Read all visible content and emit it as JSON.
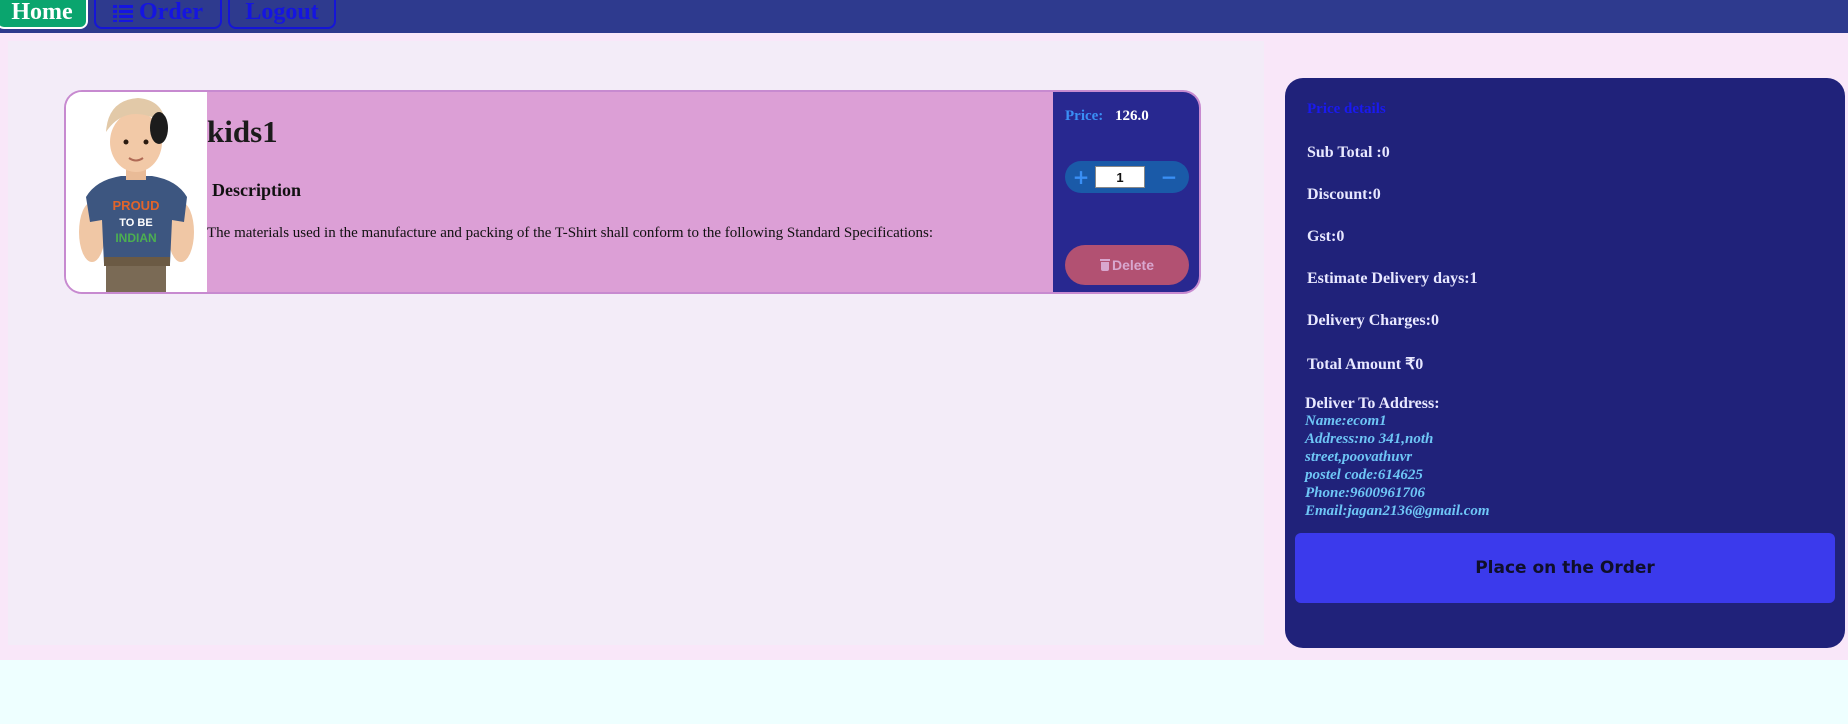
{
  "nav": {
    "home_label": "Home",
    "order_label": "Order",
    "logout_label": "Logout"
  },
  "product": {
    "name": "kids1",
    "description_heading": "Description",
    "description": "The materials used in the manufacture and packing of the T-Shirt shall conform to the following Standard Specifications:",
    "price_label": "Price:",
    "price_value": "126.0",
    "quantity": "1",
    "delete_label": "Delete",
    "image_alt": "kid wearing Proud To Be Indian t-shirt"
  },
  "summary": {
    "title": "Price details",
    "sub_total": "Sub Total :0",
    "discount": "Discount:0",
    "gst": "Gst:0",
    "delivery_days": "Estimate Delivery days:1",
    "delivery_charges": "Delivery Charges:0",
    "total": "Total Amount ₹0",
    "address_heading": "Deliver To Address:",
    "address_lines": [
      "Name:ecom1",
      "Address:no 341,noth",
      "street,poovathuvr",
      "postel code:614625",
      "Phone:9600961706",
      "Email:jagan2136@gmail.com"
    ],
    "place_order_label": "Place on the Order"
  },
  "icons": {
    "order": "list-icon",
    "delete": "trash-icon",
    "plus": "plus-icon",
    "minus": "minus-icon"
  },
  "colors": {
    "navbar": "#2e3a8e",
    "home_button": "#0aa56e",
    "card": "#dc9fd6",
    "summary_panel": "#20227a",
    "place_order": "#3b3aec",
    "delete_button": "#b25172"
  }
}
